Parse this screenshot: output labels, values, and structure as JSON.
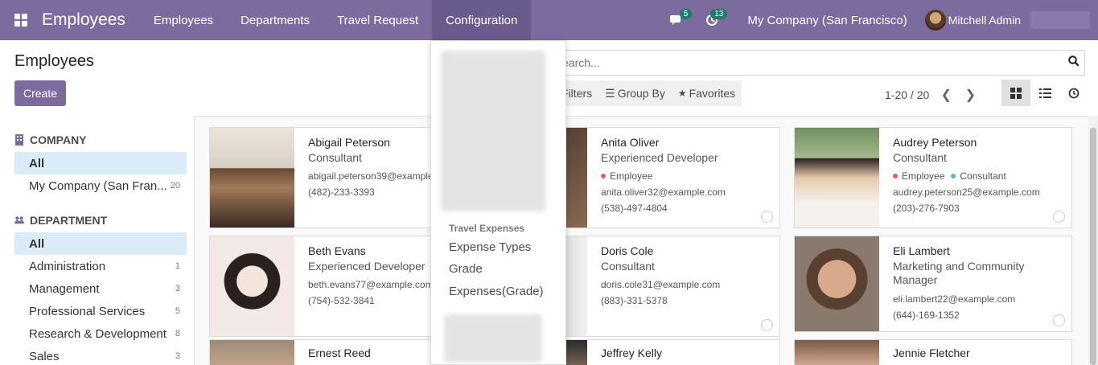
{
  "navbar": {
    "brand": "Employees",
    "menu": [
      {
        "label": "Employees"
      },
      {
        "label": "Departments"
      },
      {
        "label": "Travel Request"
      },
      {
        "label": "Configuration"
      }
    ],
    "messages_count": "5",
    "activities_count": "13",
    "company": "My Company (San Francisco)",
    "user": "Mitchell Admin"
  },
  "control": {
    "breadcrumb": "Employees",
    "create_label": "Create",
    "search_placeholder": "earch...",
    "filters_label": "Filters",
    "groupby_label": "Group By",
    "favorites_label": "Favorites",
    "pager": "1-20 / 20"
  },
  "sidebar": {
    "company_header": "COMPANY",
    "company_items": [
      {
        "label": "All",
        "count": ""
      },
      {
        "label": "My Company (San Fran...",
        "count": "20"
      }
    ],
    "department_header": "DEPARTMENT",
    "department_items": [
      {
        "label": "All",
        "count": ""
      },
      {
        "label": "Administration",
        "count": "1"
      },
      {
        "label": "Management",
        "count": "3"
      },
      {
        "label": "Professional Services",
        "count": "5"
      },
      {
        "label": "Research & Development",
        "count": "8"
      },
      {
        "label": "Sales",
        "count": "3"
      }
    ]
  },
  "cards": [
    {
      "name": "Abigail Peterson",
      "job": "Consultant",
      "tags": [],
      "email": "abigail.peterson39@example.com",
      "phone": "(482)-233-3393"
    },
    {
      "name": "Anita Oliver",
      "job": "Experienced Developer",
      "tags": [
        "Employee"
      ],
      "email": "anita.oliver32@example.com",
      "phone": "(538)-497-4804"
    },
    {
      "name": "Audrey Peterson",
      "job": "Consultant",
      "tags": [
        "Employee",
        "Consultant"
      ],
      "email": "audrey.peterson25@example.com",
      "phone": "(203)-276-7903"
    },
    {
      "name": "Beth Evans",
      "job": "Experienced Developer",
      "tags": [],
      "email": "beth.evans77@example.com",
      "phone": "(754)-532-3841"
    },
    {
      "name": "Doris Cole",
      "job": "Consultant",
      "tags": [],
      "email": "doris.cole31@example.com",
      "phone": "(883)-331-5378"
    },
    {
      "name": "Eli Lambert",
      "job": "Marketing and Community Manager",
      "tags": [],
      "email": "eli.lambert22@example.com",
      "phone": "(644)-169-1352"
    },
    {
      "name": "Ernest Reed",
      "job": "",
      "tags": [],
      "email": "",
      "phone": ""
    },
    {
      "name": "Jeffrey Kelly",
      "job": "",
      "tags": [],
      "email": "",
      "phone": ""
    },
    {
      "name": "Jennie Fletcher",
      "job": "",
      "tags": [],
      "email": "",
      "phone": ""
    }
  ],
  "dropdown": {
    "section_header": "Travel Expenses",
    "items": [
      "Expense Types",
      "Grade",
      "Expenses(Grade)"
    ]
  },
  "colors": {
    "brand": "#7c6b9e",
    "employee_tag": "#e05c6a",
    "consultant_tag": "#4fb8d8"
  }
}
